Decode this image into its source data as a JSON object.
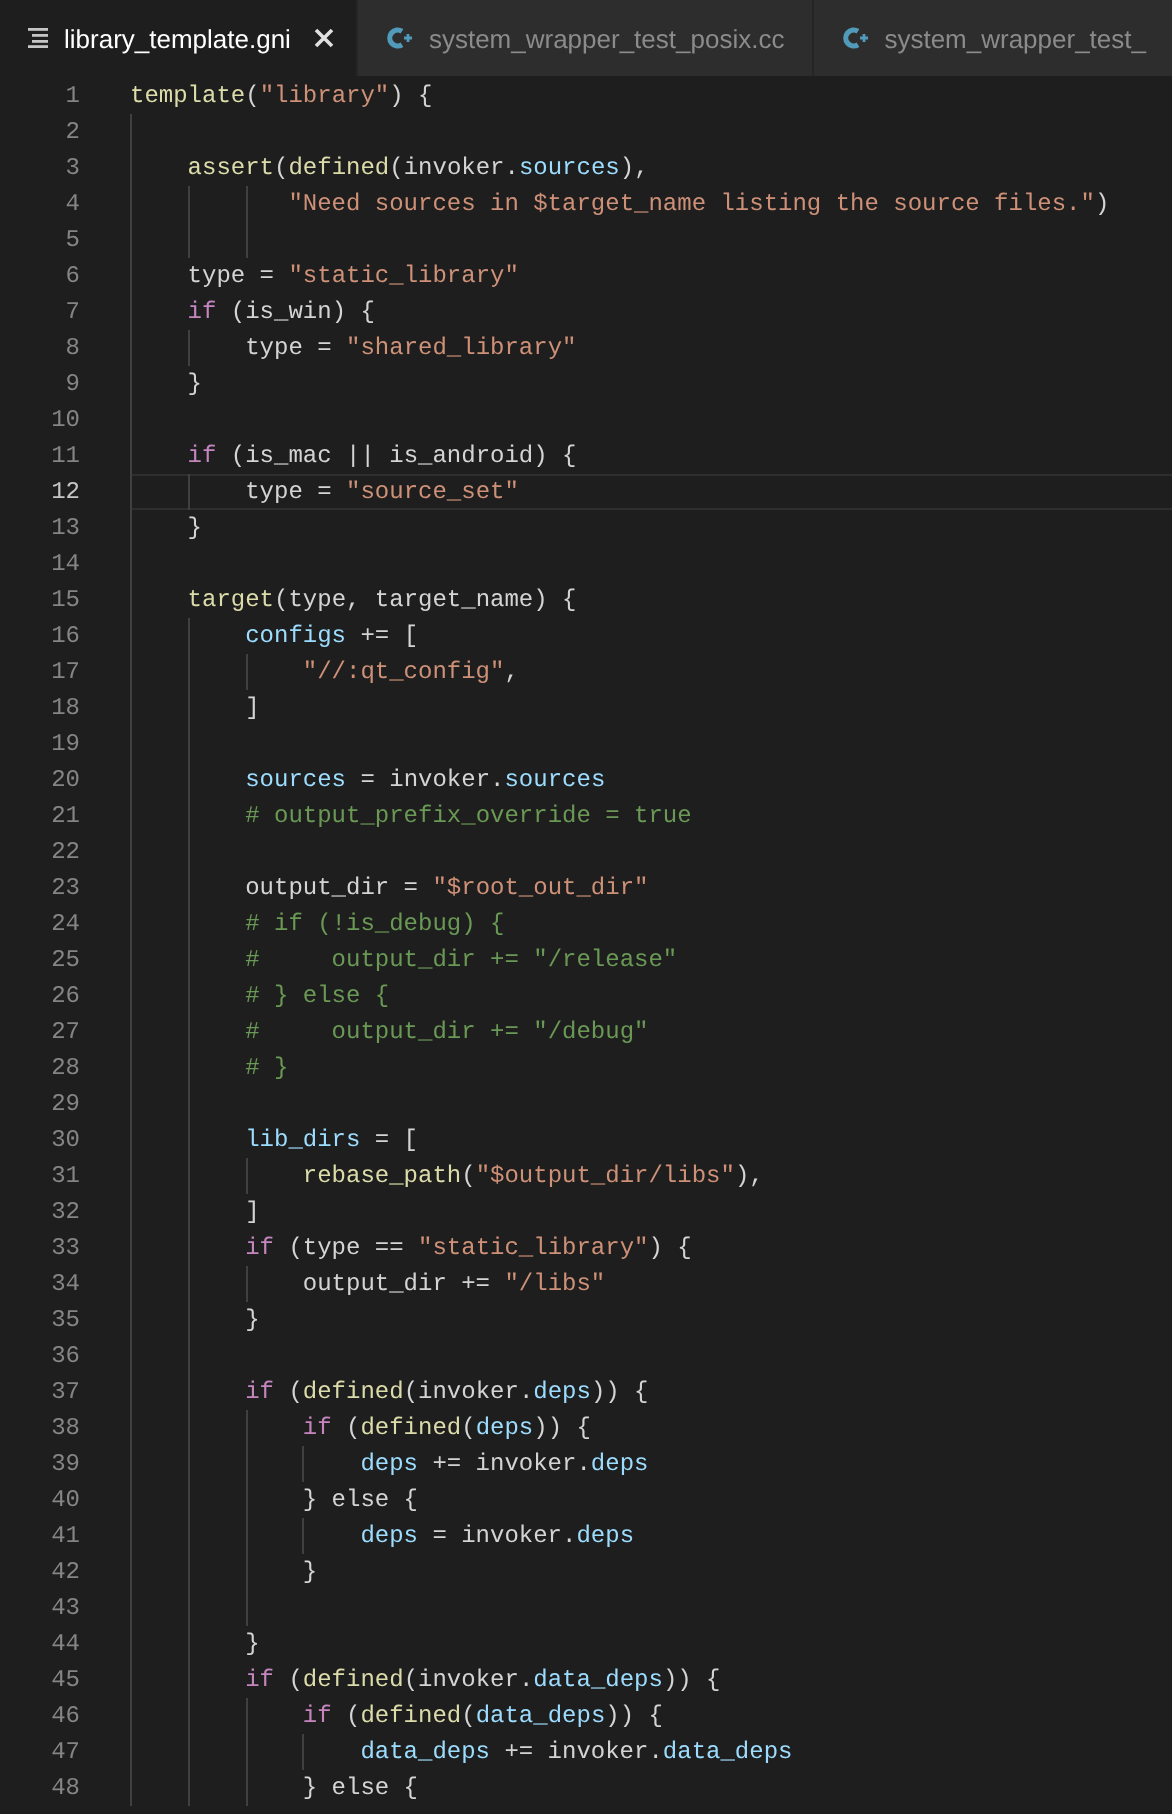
{
  "tabs": [
    {
      "label": "library_template.gni",
      "kind": "text",
      "selected": true,
      "closable": true
    },
    {
      "label": "system_wrapper_test_posix.cc",
      "kind": "cpp",
      "selected": false,
      "closable": false
    },
    {
      "label": "system_wrapper_test_",
      "kind": "cpp",
      "selected": false,
      "closable": false
    }
  ],
  "editor": {
    "lines": [
      {
        "number": "1",
        "current": false,
        "tokens": [
          {
            "kind": "fn",
            "text": "template"
          },
          {
            "kind": "tx",
            "text": "("
          },
          {
            "kind": "str",
            "text": "\"library\""
          },
          {
            "kind": "tx",
            "text": ") {"
          }
        ]
      },
      {
        "number": "2",
        "current": false
      },
      {
        "number": "3",
        "current": false,
        "tokens": [
          {
            "kind": "fn",
            "text": "    assert"
          },
          {
            "kind": "tx",
            "text": "("
          },
          {
            "kind": "fn",
            "text": "defined"
          },
          {
            "kind": "tx",
            "text": "(invoker."
          },
          {
            "kind": "var",
            "text": "sources"
          },
          {
            "kind": "tx",
            "text": "),"
          }
        ]
      },
      {
        "number": "4",
        "current": false,
        "tokens": [
          {
            "kind": "str",
            "text": "           \"Need sources in $target_name listing the source files.\""
          },
          {
            "kind": "tx",
            "text": ")"
          }
        ]
      },
      {
        "number": "5",
        "current": false
      },
      {
        "number": "6",
        "current": false,
        "tokens": [
          {
            "kind": "tx",
            "text": "    type = "
          },
          {
            "kind": "str",
            "text": "\"static_library\""
          }
        ]
      },
      {
        "number": "7",
        "current": false,
        "tokens": [
          {
            "kind": "kw",
            "text": "    if"
          },
          {
            "kind": "tx",
            "text": " (is_win) {"
          }
        ]
      },
      {
        "number": "8",
        "current": false,
        "tokens": [
          {
            "kind": "tx",
            "text": "        type = "
          },
          {
            "kind": "str",
            "text": "\"shared_library\""
          }
        ]
      },
      {
        "number": "9",
        "current": false,
        "tokens": [
          {
            "kind": "tx",
            "text": "    }"
          }
        ]
      },
      {
        "number": "10",
        "current": false
      },
      {
        "number": "11",
        "current": false,
        "tokens": [
          {
            "kind": "kw",
            "text": "    if"
          },
          {
            "kind": "tx",
            "text": " (is_mac || is_android) {"
          }
        ]
      },
      {
        "number": "12",
        "current": true,
        "tokens": [
          {
            "kind": "tx",
            "text": "        type = "
          },
          {
            "kind": "str",
            "text": "\"source_set\""
          }
        ]
      },
      {
        "number": "13",
        "current": false,
        "tokens": [
          {
            "kind": "tx",
            "text": "    }"
          }
        ]
      },
      {
        "number": "14",
        "current": false
      },
      {
        "number": "15",
        "current": false,
        "tokens": [
          {
            "kind": "fn",
            "text": "    target"
          },
          {
            "kind": "tx",
            "text": "(type, target_name) {"
          }
        ]
      },
      {
        "number": "16",
        "current": false,
        "tokens": [
          {
            "kind": "var",
            "text": "        configs"
          },
          {
            "kind": "tx",
            "text": " += ["
          }
        ]
      },
      {
        "number": "17",
        "current": false,
        "tokens": [
          {
            "kind": "str",
            "text": "            \"//:qt_config\""
          },
          {
            "kind": "tx",
            "text": ","
          }
        ]
      },
      {
        "number": "18",
        "current": false,
        "tokens": [
          {
            "kind": "tx",
            "text": "        ]"
          }
        ]
      },
      {
        "number": "19",
        "current": false
      },
      {
        "number": "20",
        "current": false,
        "tokens": [
          {
            "kind": "var",
            "text": "        sources"
          },
          {
            "kind": "tx",
            "text": " = invoker."
          },
          {
            "kind": "var",
            "text": "sources"
          }
        ]
      },
      {
        "number": "21",
        "current": false,
        "tokens": [
          {
            "kind": "cm",
            "text": "        # output_prefix_override = true"
          }
        ]
      },
      {
        "number": "22",
        "current": false
      },
      {
        "number": "23",
        "current": false,
        "tokens": [
          {
            "kind": "tx",
            "text": "        output_dir = "
          },
          {
            "kind": "str",
            "text": "\"$root_out_dir\""
          }
        ]
      },
      {
        "number": "24",
        "current": false,
        "tokens": [
          {
            "kind": "cm",
            "text": "        # if (!is_debug) {"
          }
        ]
      },
      {
        "number": "25",
        "current": false,
        "tokens": [
          {
            "kind": "cm",
            "text": "        #     output_dir += \"/release\""
          }
        ]
      },
      {
        "number": "26",
        "current": false,
        "tokens": [
          {
            "kind": "cm",
            "text": "        # } else {"
          }
        ]
      },
      {
        "number": "27",
        "current": false,
        "tokens": [
          {
            "kind": "cm",
            "text": "        #     output_dir += \"/debug\""
          }
        ]
      },
      {
        "number": "28",
        "current": false,
        "tokens": [
          {
            "kind": "cm",
            "text": "        # }"
          }
        ]
      },
      {
        "number": "29",
        "current": false
      },
      {
        "number": "30",
        "current": false,
        "tokens": [
          {
            "kind": "var",
            "text": "        lib_dirs"
          },
          {
            "kind": "tx",
            "text": " = ["
          }
        ]
      },
      {
        "number": "31",
        "current": false,
        "tokens": [
          {
            "kind": "fn",
            "text": "            rebase_path"
          },
          {
            "kind": "tx",
            "text": "("
          },
          {
            "kind": "str",
            "text": "\"$output_dir/libs\""
          },
          {
            "kind": "tx",
            "text": "),"
          }
        ]
      },
      {
        "number": "32",
        "current": false,
        "tokens": [
          {
            "kind": "tx",
            "text": "        ]"
          }
        ]
      },
      {
        "number": "33",
        "current": false,
        "tokens": [
          {
            "kind": "kw",
            "text": "        if"
          },
          {
            "kind": "tx",
            "text": " (type == "
          },
          {
            "kind": "str",
            "text": "\"static_library\""
          },
          {
            "kind": "tx",
            "text": ") {"
          }
        ]
      },
      {
        "number": "34",
        "current": false,
        "tokens": [
          {
            "kind": "tx",
            "text": "            output_dir += "
          },
          {
            "kind": "str",
            "text": "\"/libs\""
          }
        ]
      },
      {
        "number": "35",
        "current": false,
        "tokens": [
          {
            "kind": "tx",
            "text": "        }"
          }
        ]
      },
      {
        "number": "36",
        "current": false
      },
      {
        "number": "37",
        "current": false,
        "tokens": [
          {
            "kind": "kw",
            "text": "        if"
          },
          {
            "kind": "tx",
            "text": " ("
          },
          {
            "kind": "fn",
            "text": "defined"
          },
          {
            "kind": "tx",
            "text": "(invoker."
          },
          {
            "kind": "var",
            "text": "deps"
          },
          {
            "kind": "tx",
            "text": ")) {"
          }
        ]
      },
      {
        "number": "38",
        "current": false,
        "tokens": [
          {
            "kind": "kw",
            "text": "            if"
          },
          {
            "kind": "tx",
            "text": " ("
          },
          {
            "kind": "fn",
            "text": "defined"
          },
          {
            "kind": "tx",
            "text": "("
          },
          {
            "kind": "var",
            "text": "deps"
          },
          {
            "kind": "tx",
            "text": ")) {"
          }
        ]
      },
      {
        "number": "39",
        "current": false,
        "tokens": [
          {
            "kind": "var",
            "text": "                deps"
          },
          {
            "kind": "tx",
            "text": " += invoker."
          },
          {
            "kind": "var",
            "text": "deps"
          }
        ]
      },
      {
        "number": "40",
        "current": false,
        "tokens": [
          {
            "kind": "tx",
            "text": "            } else {"
          }
        ]
      },
      {
        "number": "41",
        "current": false,
        "tokens": [
          {
            "kind": "var",
            "text": "                deps"
          },
          {
            "kind": "tx",
            "text": " = invoker."
          },
          {
            "kind": "var",
            "text": "deps"
          }
        ]
      },
      {
        "number": "42",
        "current": false,
        "tokens": [
          {
            "kind": "tx",
            "text": "            }"
          }
        ]
      },
      {
        "number": "43",
        "current": false
      },
      {
        "number": "44",
        "current": false,
        "tokens": [
          {
            "kind": "tx",
            "text": "        }"
          }
        ]
      },
      {
        "number": "45",
        "current": false,
        "tokens": [
          {
            "kind": "kw",
            "text": "        if"
          },
          {
            "kind": "tx",
            "text": " ("
          },
          {
            "kind": "fn",
            "text": "defined"
          },
          {
            "kind": "tx",
            "text": "(invoker."
          },
          {
            "kind": "var",
            "text": "data_deps"
          },
          {
            "kind": "tx",
            "text": ")) {"
          }
        ]
      },
      {
        "number": "46",
        "current": false,
        "tokens": [
          {
            "kind": "kw",
            "text": "            if"
          },
          {
            "kind": "tx",
            "text": " ("
          },
          {
            "kind": "fn",
            "text": "defined"
          },
          {
            "kind": "tx",
            "text": "("
          },
          {
            "kind": "var",
            "text": "data_deps"
          },
          {
            "kind": "tx",
            "text": ")) {"
          }
        ]
      },
      {
        "number": "47",
        "current": false,
        "tokens": [
          {
            "kind": "var",
            "text": "                data_deps"
          },
          {
            "kind": "tx",
            "text": " += invoker."
          },
          {
            "kind": "var",
            "text": "data_deps"
          }
        ]
      },
      {
        "number": "48",
        "current": false,
        "tokens": [
          {
            "kind": "tx",
            "text": "            } else {"
          }
        ]
      }
    ]
  }
}
